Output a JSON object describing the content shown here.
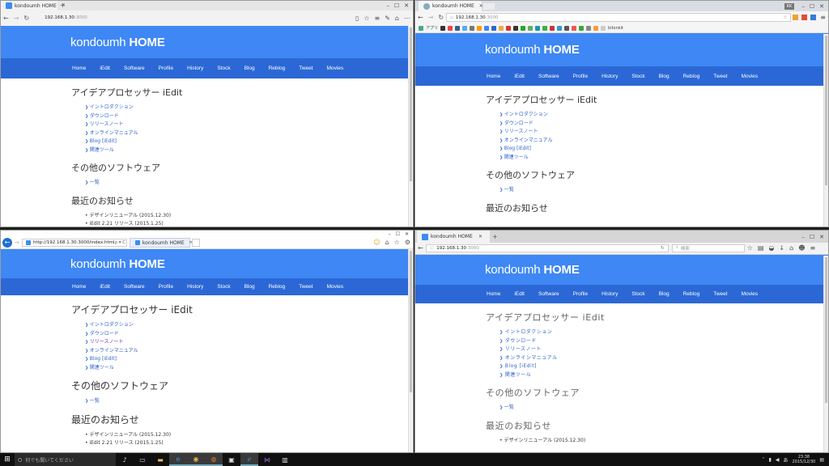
{
  "site": {
    "title_light": "kondoumh ",
    "title_bold": "HOME",
    "nav": [
      "Home",
      "iEdit",
      "Software",
      "Profile",
      "History",
      "Stock",
      "Blog",
      "Reblog",
      "Tweet",
      "Movies"
    ],
    "h_iedit": "アイデアプロセッサー iEdit",
    "iedit_links": [
      "イントロダクション",
      "ダウンロード",
      "リリースノート",
      "オンラインマニュアル",
      "Blog [iEdit]",
      "関連ツール"
    ],
    "h_other": "その他のソフトウェア",
    "other_links": [
      "一覧"
    ],
    "h_news": "最近のお知らせ",
    "news": [
      "デザインリニューアル (2015.12.30)",
      "iEdit 2.21 リリース (2015.1.25)"
    ]
  },
  "edge": {
    "tab_title": "kondoumh HOME",
    "url_host": "192.168.1.30",
    "url_rest": ":3000"
  },
  "chrome": {
    "tab_title": "kondoumh HOME",
    "url_host": "192.168.1.30",
    "url_rest": ":3000",
    "bookmarks_apps": "アプリ",
    "bookmarks_end": "bitonkit",
    "user_badge": "KK"
  },
  "ie": {
    "url": "http://192.168.1.30:3000/index.html",
    "url_suffix": "ρ ▾ C",
    "tab_title": "kondoumh HOME"
  },
  "firefox": {
    "tab_title": "kondoumh HOME",
    "url_host": "192.168.1.30",
    "url_rest": ":3000",
    "search_placeholder": "検索"
  },
  "taskbar": {
    "search_placeholder": "何でも聞いてください",
    "time": "23:38",
    "date": "2015/12/30"
  },
  "colors": {
    "header": "#3e87f5",
    "nav": "#2b68d6",
    "link": "#2d62c8"
  }
}
